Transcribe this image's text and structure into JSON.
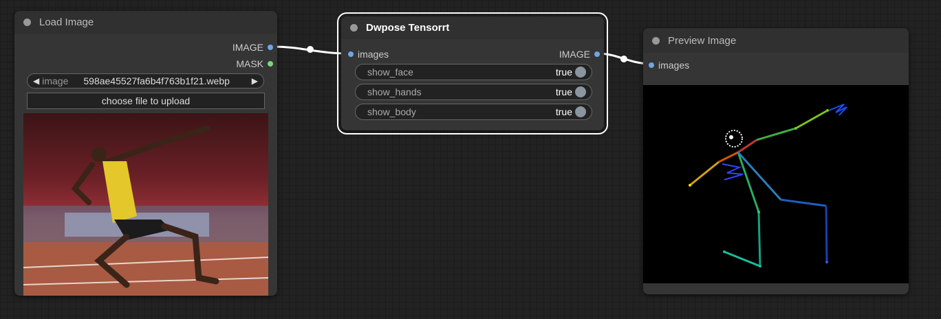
{
  "nodes": {
    "load_image": {
      "title": "Load Image",
      "outputs": [
        "IMAGE",
        "MASK"
      ],
      "image_widget": {
        "label": "image",
        "value": "598ae45527fa6b4f763b1f21.webp"
      },
      "upload_button": "choose file to upload",
      "preview_alt": "athlete-pose-photo"
    },
    "dwpose": {
      "title": "Dwpose Tensorrt",
      "input": "images",
      "output": "IMAGE",
      "toggles": [
        {
          "label": "show_face",
          "value": "true"
        },
        {
          "label": "show_hands",
          "value": "true"
        },
        {
          "label": "show_body",
          "value": "true"
        }
      ]
    },
    "preview_image": {
      "title": "Preview Image",
      "input": "images"
    }
  },
  "colors": {
    "link": "#ffffff",
    "image_slot": "#6ba7e8",
    "mask_slot": "#7fd67a",
    "selected_outline": "#ffffff"
  },
  "icons": [
    "arrow-left-icon",
    "arrow-right-icon"
  ]
}
